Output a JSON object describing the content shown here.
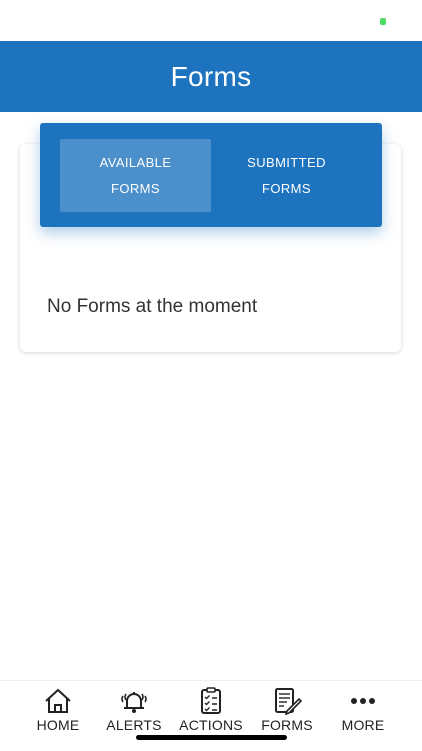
{
  "header": {
    "title": "Forms"
  },
  "tabs": [
    {
      "line1": "AVAILABLE",
      "line2": "FORMS",
      "active": true
    },
    {
      "line1": "SUBMITTED",
      "line2": "FORMS",
      "active": false
    }
  ],
  "content": {
    "empty_message": "No Forms at the moment"
  },
  "bottom_nav": [
    {
      "label": "HOME",
      "icon": "home-icon"
    },
    {
      "label": "ALERTS",
      "icon": "bell-icon"
    },
    {
      "label": "ACTIONS",
      "icon": "clipboard-checklist-icon"
    },
    {
      "label": "FORMS",
      "icon": "form-edit-icon"
    },
    {
      "label": "MORE",
      "icon": "more-dots-icon"
    }
  ],
  "colors": {
    "brand": "#1e73be",
    "status_dot": "#4cd964"
  }
}
